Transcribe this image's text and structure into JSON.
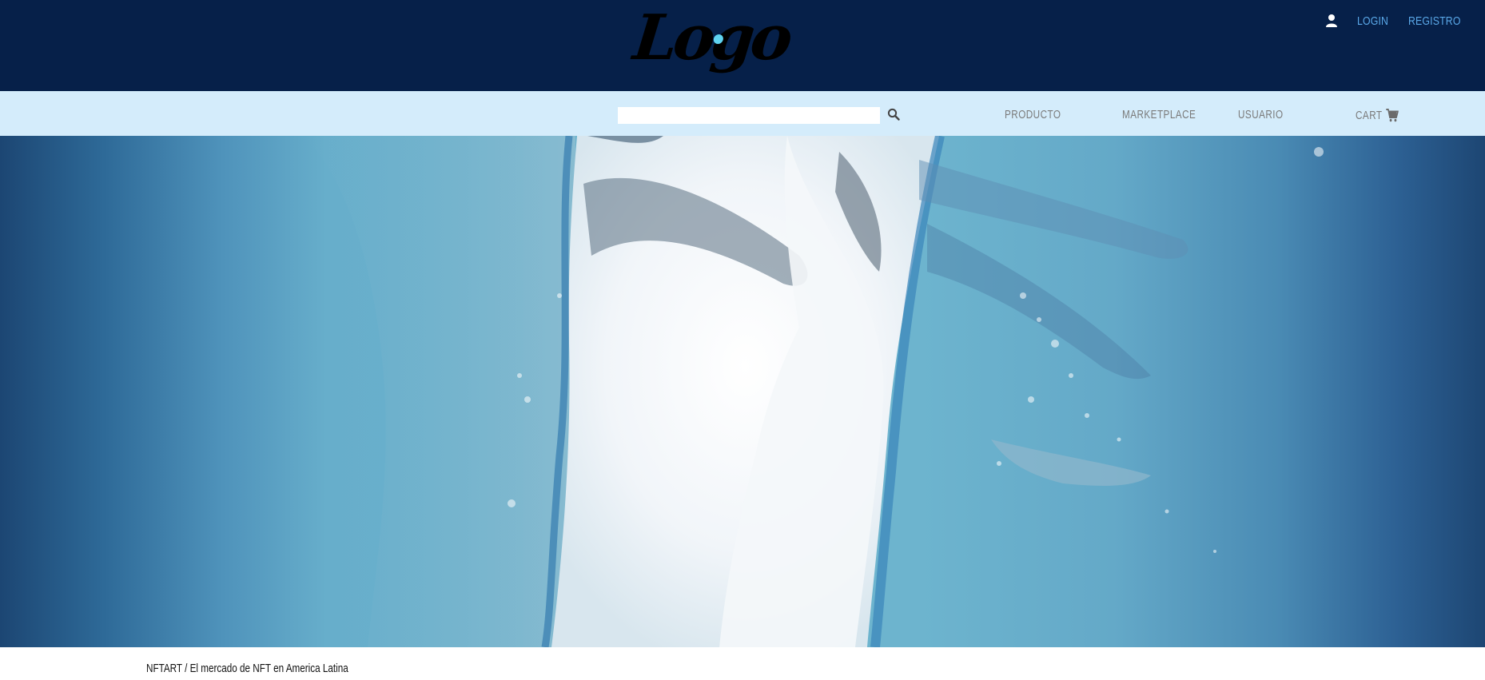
{
  "header": {
    "logo_text": "Logo",
    "logo_dot_color": "#5fd3f0",
    "background_color": "#062049",
    "account": {
      "user_icon": "user-icon",
      "login_label": "LOGIN",
      "register_label": "REGISTRO",
      "link_color": "#5aa8e8"
    }
  },
  "navbar": {
    "background_color": "#d4ecfb",
    "search": {
      "value": "",
      "placeholder": "",
      "icon": "search-icon"
    },
    "items": [
      {
        "label": "PRODUCTO"
      },
      {
        "label": "MARKETPLACE"
      },
      {
        "label": "USUARIO"
      },
      {
        "label": "CART",
        "icon": "cart-icon"
      }
    ]
  },
  "hero": {
    "image_alt": "hero-image",
    "colors": [
      "#1c4673",
      "#6db4ce",
      "#ffffff"
    ]
  },
  "footer": {
    "tagline": "NFTART / El mercado de NFT en America Latina"
  }
}
